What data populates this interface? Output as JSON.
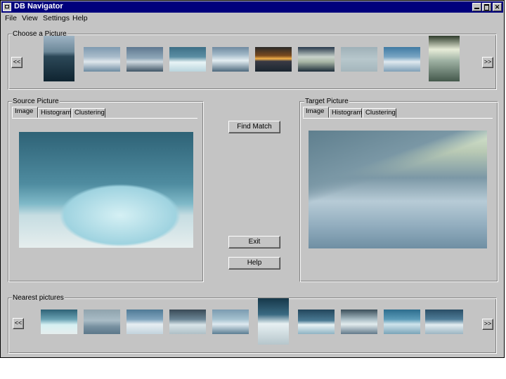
{
  "window": {
    "title": "DB Navigator"
  },
  "menu": [
    "File",
    "View",
    "Settings",
    "Help"
  ],
  "choose": {
    "label": "Choose a Picture",
    "prev": "<<",
    "next": ">>"
  },
  "source": {
    "label": "Source Picture",
    "tabs": [
      "Image",
      "Histogram",
      "Clustering"
    ]
  },
  "target": {
    "label": "Target Picture",
    "tabs": [
      "Image",
      "Histogram",
      "Clustering"
    ]
  },
  "buttons": {
    "find_match": "Find Match",
    "exit": "Exit",
    "help": "Help"
  },
  "nearest": {
    "label": "Nearest pictures",
    "prev": "<<",
    "next": ">>"
  }
}
